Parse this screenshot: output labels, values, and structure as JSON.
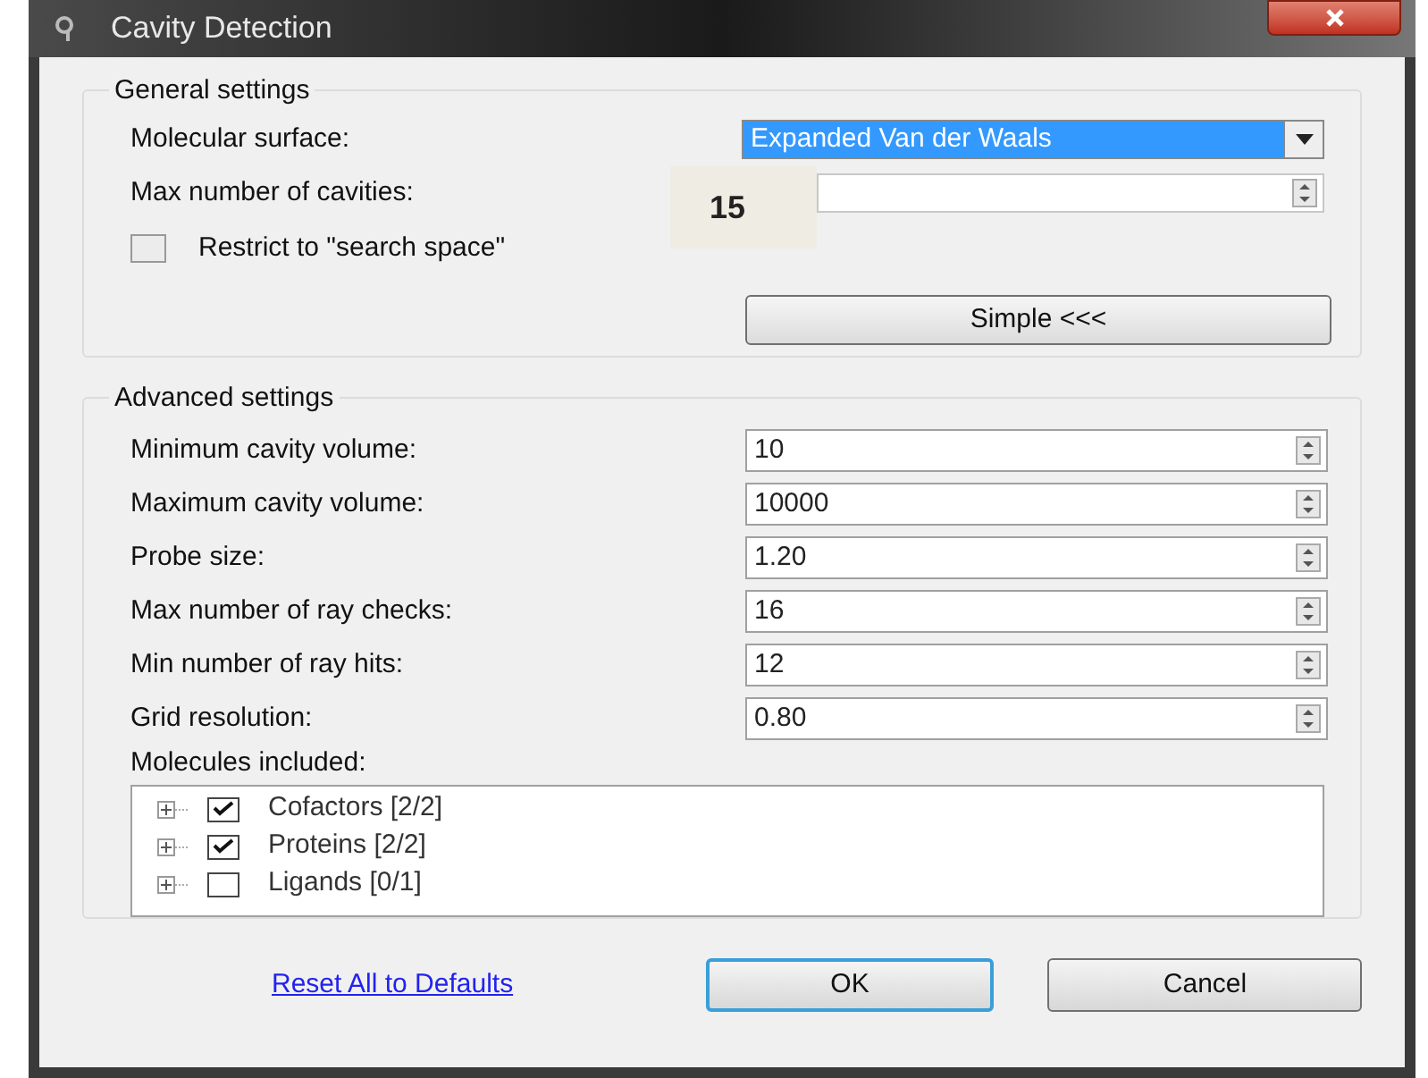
{
  "window": {
    "title": "Cavity Detection"
  },
  "general_settings": {
    "title": "General settings",
    "molecular_surface": {
      "label": "Molecular surface:",
      "value": "Expanded Van der Waals"
    },
    "max_cavities": {
      "label": "Max number of cavities:",
      "overlay": "15"
    },
    "restrict": {
      "label": "Restrict to \"search space\"",
      "checked": false
    },
    "simple_button": "Simple <<<"
  },
  "advanced_settings": {
    "title": "Advanced settings",
    "fields": [
      {
        "label": "Minimum cavity volume:",
        "value": "10"
      },
      {
        "label": "Maximum cavity volume:",
        "value": "10000"
      },
      {
        "label": "Probe size:",
        "value": "1.20"
      },
      {
        "label": "Max number of ray checks:",
        "value": "16"
      },
      {
        "label": "Min number of ray hits:",
        "value": "12"
      },
      {
        "label": "Grid resolution:",
        "value": "0.80"
      }
    ],
    "molecules_label": "Molecules included:",
    "molecules": [
      {
        "name": "Cofactors",
        "count": "[2/2]",
        "checked": true,
        "expanded": false
      },
      {
        "name": "Proteins",
        "count": "[2/2]",
        "checked": true,
        "expanded": false
      },
      {
        "name": "Ligands",
        "count": "[0/1]",
        "checked": false,
        "expanded": false
      }
    ]
  },
  "footer": {
    "reset_link": "Reset All to Defaults",
    "buttons": [
      {
        "label": "OK",
        "default": true
      },
      {
        "label": "Cancel",
        "default": false
      }
    ]
  }
}
